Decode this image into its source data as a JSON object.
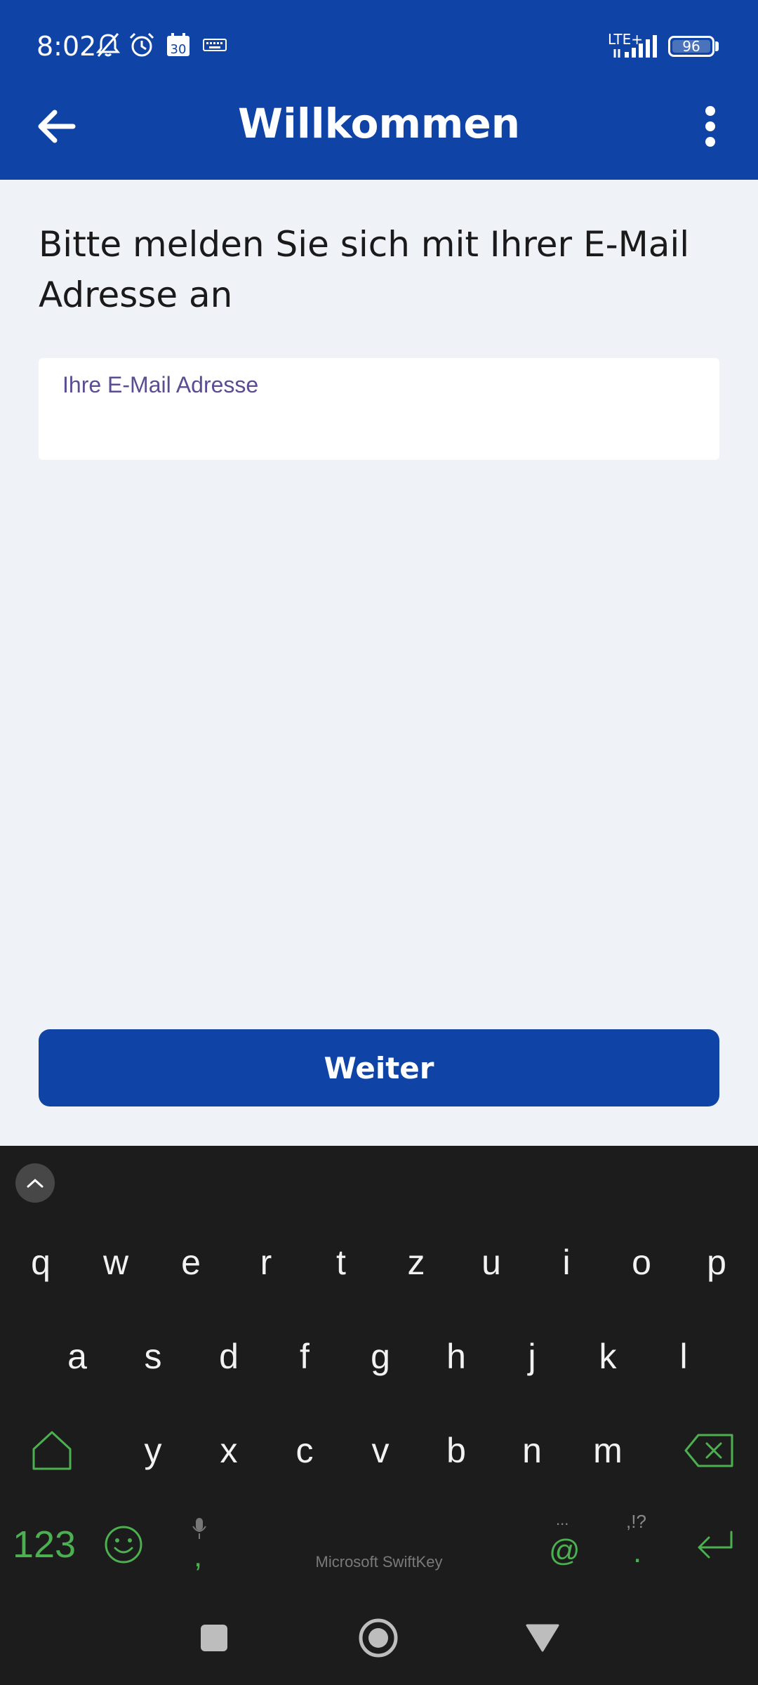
{
  "status_bar": {
    "time": "8:02",
    "calendar_day": "30",
    "network": "LTE+",
    "battery": "96"
  },
  "app_bar": {
    "title": "Willkommen"
  },
  "content": {
    "prompt": "Bitte melden Sie sich mit Ihrer E-Mail Adresse an",
    "email_label": "Ihre E-Mail Adresse",
    "email_value": "",
    "continue_label": "Weiter"
  },
  "keyboard": {
    "row1": [
      "q",
      "w",
      "e",
      "r",
      "t",
      "z",
      "u",
      "i",
      "o",
      "p"
    ],
    "row2": [
      "a",
      "s",
      "d",
      "f",
      "g",
      "h",
      "j",
      "k",
      "l"
    ],
    "row3": [
      "y",
      "x",
      "c",
      "v",
      "b",
      "n",
      "m"
    ],
    "numbers_key": "123",
    "comma_key": ",",
    "at_key": "@",
    "period_key": ".",
    "at_hint": "...",
    "period_hint": ",!?",
    "brand": "Microsoft SwiftKey"
  },
  "colors": {
    "primary": "#0f44a6",
    "background": "#eff3f8",
    "keyboard_bg": "#1c1c1c",
    "accent_green": "#4caf50",
    "label_purple": "#5b4d91"
  }
}
